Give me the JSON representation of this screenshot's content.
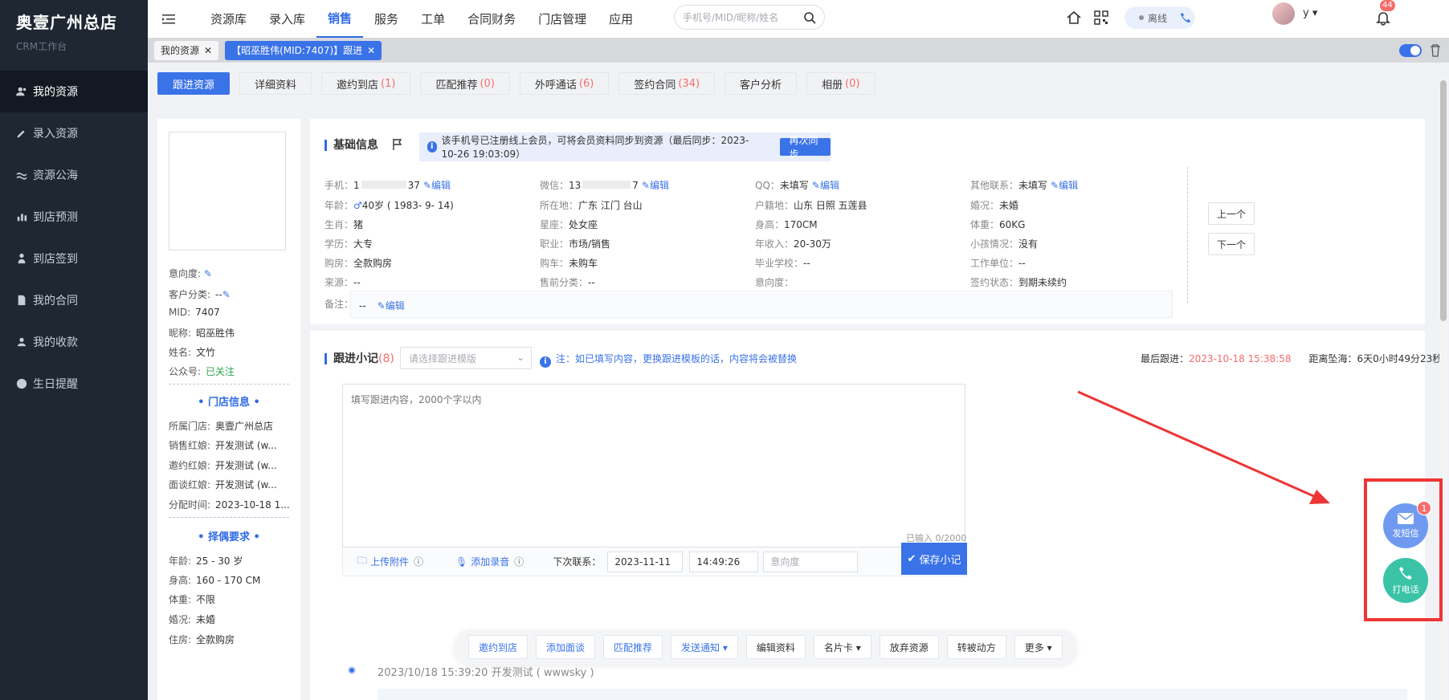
{
  "brand": {
    "title": "奥壹广州总店",
    "subtitle": "CRM工作台"
  },
  "sidebar": {
    "items": [
      {
        "label": "我的资源",
        "icon": "user-group-icon",
        "active": true
      },
      {
        "label": "录入资源",
        "icon": "pencil-icon"
      },
      {
        "label": "资源公海",
        "icon": "sea-icon"
      },
      {
        "label": "到店预测",
        "icon": "bar-chart-icon"
      },
      {
        "label": "到店签到",
        "icon": "person-icon"
      },
      {
        "label": "我的合同",
        "icon": "document-icon"
      },
      {
        "label": "我的收款",
        "icon": "wallet-icon"
      },
      {
        "label": "生日提醒",
        "icon": "birthday-icon"
      }
    ]
  },
  "topnav": {
    "items": [
      "资源库",
      "录入库",
      "销售",
      "服务",
      "工单",
      "合同财务",
      "门店管理",
      "应用"
    ],
    "active": "销售"
  },
  "search": {
    "placeholder": "手机号/MID/昵称/姓名"
  },
  "status": {
    "label": "离线"
  },
  "user": {
    "name": "y",
    "notifications": "44"
  },
  "page_tabs": [
    {
      "label": "我的资源",
      "active": false
    },
    {
      "label": "【昭巫胜伟(MID:7407)】跟进",
      "active": true
    }
  ],
  "subtabs": [
    {
      "label": "跟进资源",
      "count": "",
      "active": true
    },
    {
      "label": "详细资料",
      "count": ""
    },
    {
      "label": "邀约到店",
      "count": "(1)"
    },
    {
      "label": "匹配推荐",
      "count": "(0)"
    },
    {
      "label": "外呼通话",
      "count": "(6)"
    },
    {
      "label": "签约合同",
      "count": "(34)"
    },
    {
      "label": "客户分析",
      "count": ""
    },
    {
      "label": "相册",
      "count": "(0)"
    }
  ],
  "left_panel": {
    "intent_label": "意向度:",
    "category_label": "客户分类:",
    "category_value": "--",
    "mid_label": "MID:",
    "mid_value": "7407",
    "nickname_label": "昵称:",
    "nickname_value": "昭巫胜伟",
    "name_label": "姓名:",
    "name_value": "文竹",
    "public_label": "公众号:",
    "public_value": "已关注",
    "store_section": "门店信息",
    "store_label": "所属门店:",
    "store_value": "奥壹广州总店",
    "sales_label": "销售红娘:",
    "sales_value": "开发测试 (w...",
    "invite_label": "邀约红娘:",
    "invite_value": "开发测试 (w...",
    "interview_label": "面谈红娘:",
    "interview_value": "开发测试 (w...",
    "assign_label": "分配时间:",
    "assign_value": "2023-10-18 1...",
    "spouse_section": "择偶要求",
    "age_label": "年龄:",
    "age_value": "25 - 30 岁",
    "height_label": "身高:",
    "height_value": "160 - 170 CM",
    "weight_label": "体重:",
    "weight_value": "不限",
    "marriage_label": "婚况:",
    "marriage_value": "未婚",
    "house_label": "住房:",
    "house_value": "全款购房"
  },
  "basic": {
    "title": "基础信息",
    "banner": "该手机号已注册线上会员，可将会员资料同步到资源（最后同步：2023-10-26 19:03:09）",
    "resync": "再次同步",
    "edit": "编辑",
    "fields": {
      "phone_l": "手机：",
      "phone_v": "1",
      "phone_tail": "37",
      "wechat_l": "微信：",
      "wechat_v": "13",
      "wechat_tail": "7",
      "qq_l": "QQ：",
      "qq_v": "未填写",
      "other_l": "其他联系：",
      "other_v": "未填写",
      "age_l": "年龄：",
      "age_v": "40岁 ( 1983- 9- 14)",
      "loc_l": "所在地：",
      "loc_v": "广东 江门 台山",
      "hukou_l": "户籍地：",
      "hukou_v": "山东 日照 五莲县",
      "mar_l": "婚况：",
      "mar_v": "未婚",
      "zodiac_l": "生肖：",
      "zodiac_v": "猪",
      "star_l": "星座：",
      "star_v": "处女座",
      "height_l": "身高：",
      "height_v": "170CM",
      "weight_l": "体重：",
      "weight_v": "60KG",
      "edu_l": "学历：",
      "edu_v": "大专",
      "job_l": "职业：",
      "job_v": "市场/销售",
      "income_l": "年收入：",
      "income_v": "20-30万",
      "kids_l": "小孩情况：",
      "kids_v": "没有",
      "house_l": "购房：",
      "house_v": "全款购房",
      "car_l": "购车：",
      "car_v": "未购车",
      "school_l": "毕业学校：",
      "school_v": "--",
      "work_l": "工作单位：",
      "work_v": "--",
      "src_l": "来源：",
      "src_v": "--",
      "presale_l": "售前分类：",
      "presale_v": "--",
      "intent_l": "意向度：",
      "intent_v": "",
      "sign_l": "签约状态：",
      "sign_v": "到期未续约",
      "remark_l": "备注：",
      "remark_v": "--"
    },
    "prev": "上一个",
    "next": "下一个"
  },
  "follow": {
    "title": "跟进小记",
    "count": "(8)",
    "template_placeholder": "请选择跟进模版",
    "note": "注：如已填写内容，更换跟进模板的话，内容将会被替换",
    "last_label": "最后跟进：",
    "last_value": "2023-10-18 15:38:58",
    "sea_label": "距离坠海：",
    "sea_value": "6天0小时49分23秒",
    "textarea_placeholder": "填写跟进内容，2000个字以内",
    "input_count": "已输入 0/2000",
    "upload": "上传附件",
    "record": "添加录音",
    "next_contact": "下次联系：",
    "next_date": "2023-11-11",
    "next_time": "14:49:26",
    "intent_placeholder": "意向度",
    "save": "保存小记"
  },
  "actions": [
    {
      "label": "邀约到店",
      "blue": true
    },
    {
      "label": "添加面谈",
      "blue": true
    },
    {
      "label": "匹配推荐",
      "blue": true
    },
    {
      "label": "发送通知 ▾",
      "blue": true
    },
    {
      "label": "编辑资料",
      "blue": false
    },
    {
      "label": "名片卡 ▾",
      "blue": false
    },
    {
      "label": "放弃资源",
      "blue": false
    },
    {
      "label": "转被动方",
      "blue": false
    },
    {
      "label": "更多 ▾",
      "blue": false
    }
  ],
  "timeline": {
    "entry": "2023/10/18 15:39:20   开发测试 ( wwwsky )"
  },
  "float": {
    "sms_label": "发短信",
    "sms_badge": "1",
    "call_label": "打电话"
  },
  "colors": {
    "accent": "#3a73e8",
    "sidebar_bg": "#1f2733",
    "danger": "#f56c6c",
    "annotation": "#ee3535",
    "call_green": "#3bc3a7"
  }
}
